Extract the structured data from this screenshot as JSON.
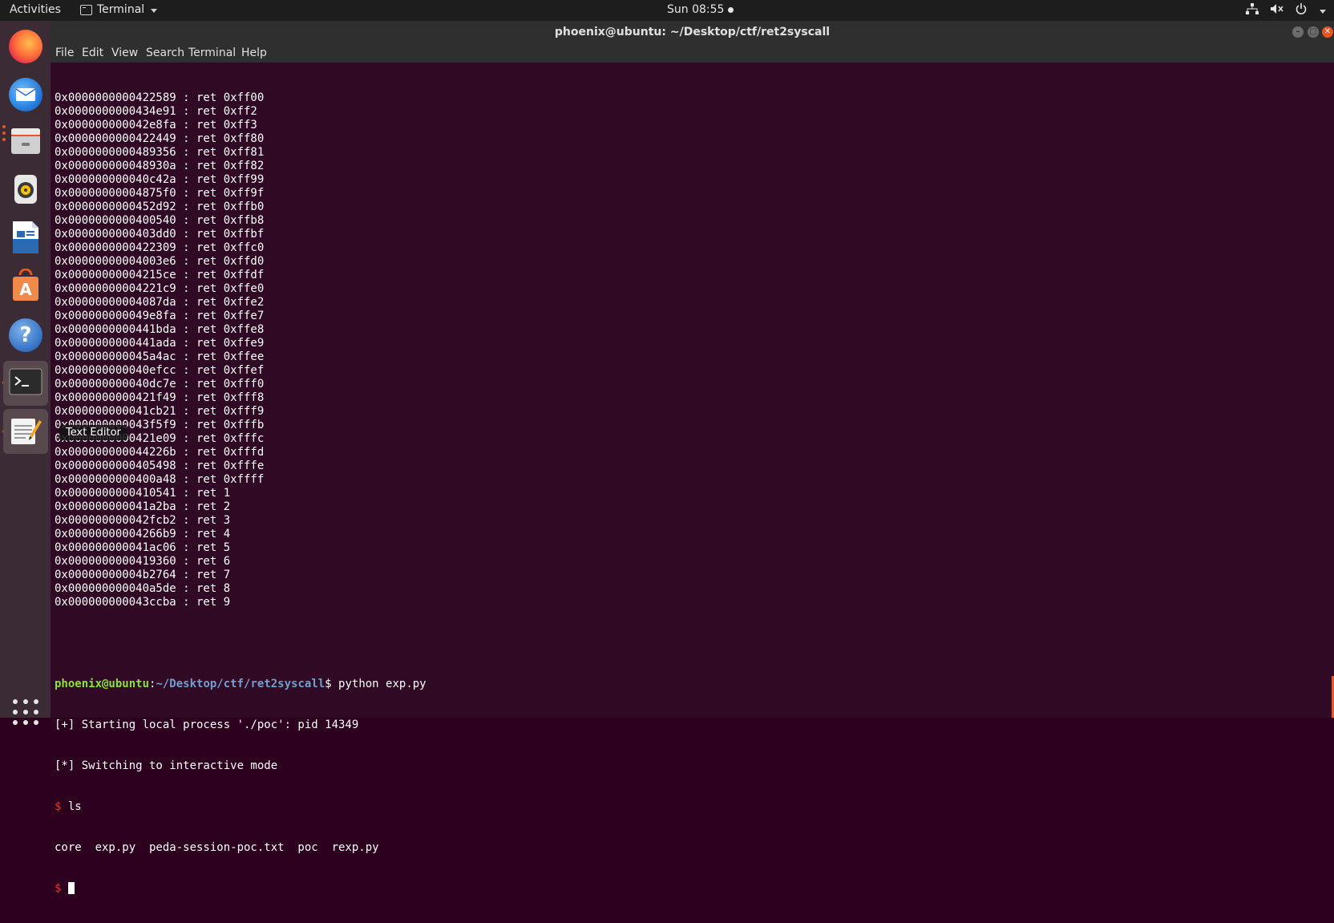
{
  "topbar": {
    "activities": "Activities",
    "app_name": "Terminal",
    "clock": "Sun 08:55"
  },
  "window": {
    "title": "phoenix@ubuntu: ~/Desktop/ctf/ret2syscall",
    "menu": [
      "File",
      "Edit",
      "View",
      "Search",
      "Terminal",
      "Help"
    ]
  },
  "dock": {
    "tooltip": "Text Editor"
  },
  "terminal": {
    "gadget_lines": [
      "0x0000000000422589 : ret 0xff00",
      "0x0000000000434e91 : ret 0xff2",
      "0x000000000042e8fa : ret 0xff3",
      "0x0000000000422449 : ret 0xff80",
      "0x0000000000489356 : ret 0xff81",
      "0x000000000048930a : ret 0xff82",
      "0x000000000040c42a : ret 0xff99",
      "0x00000000004875f0 : ret 0xff9f",
      "0x0000000000452d92 : ret 0xffb0",
      "0x0000000000400540 : ret 0xffb8",
      "0x0000000000403dd0 : ret 0xffbf",
      "0x0000000000422309 : ret 0xffc0",
      "0x00000000004003e6 : ret 0xffd0",
      "0x00000000004215ce : ret 0xffdf",
      "0x00000000004221c9 : ret 0xffe0",
      "0x00000000004087da : ret 0xffe2",
      "0x000000000049e8fa : ret 0xffe7",
      "0x0000000000441bda : ret 0xffe8",
      "0x0000000000441ada : ret 0xffe9",
      "0x000000000045a4ac : ret 0xffee",
      "0x000000000040efcc : ret 0xffef",
      "0x000000000040dc7e : ret 0xfff0",
      "0x0000000000421f49 : ret 0xfff8",
      "0x000000000041cb21 : ret 0xfff9",
      "0x000000000043f5f9 : ret 0xfffb",
      "0x0000000000421e09 : ret 0xfffc",
      "0x000000000044226b : ret 0xfffd",
      "0x0000000000405498 : ret 0xfffe",
      "0x0000000000400a48 : ret 0xffff",
      "0x0000000000410541 : ret 1",
      "0x000000000041a2ba : ret 2",
      "0x000000000042fcb2 : ret 3",
      "0x00000000004266b9 : ret 4",
      "0x000000000041ac06 : ret 5",
      "0x0000000000419360 : ret 6",
      "0x00000000004b2764 : ret 7",
      "0x000000000040a5de : ret 8",
      "0x000000000043ccba : ret 9"
    ],
    "prompt_user": "phoenix@ubuntu",
    "prompt_colon": ":",
    "prompt_path": "~/Desktop/ctf/ret2syscall",
    "prompt_dollar": "$ ",
    "command": "python exp.py",
    "output_lines": [
      "[+] Starting local process './poc': pid 14349",
      "[*] Switching to interactive mode"
    ],
    "shell_prompt": "$ ",
    "shell_command": "ls",
    "ls_output": "core  exp.py  peda-session-poc.txt  poc  rexp.py"
  }
}
